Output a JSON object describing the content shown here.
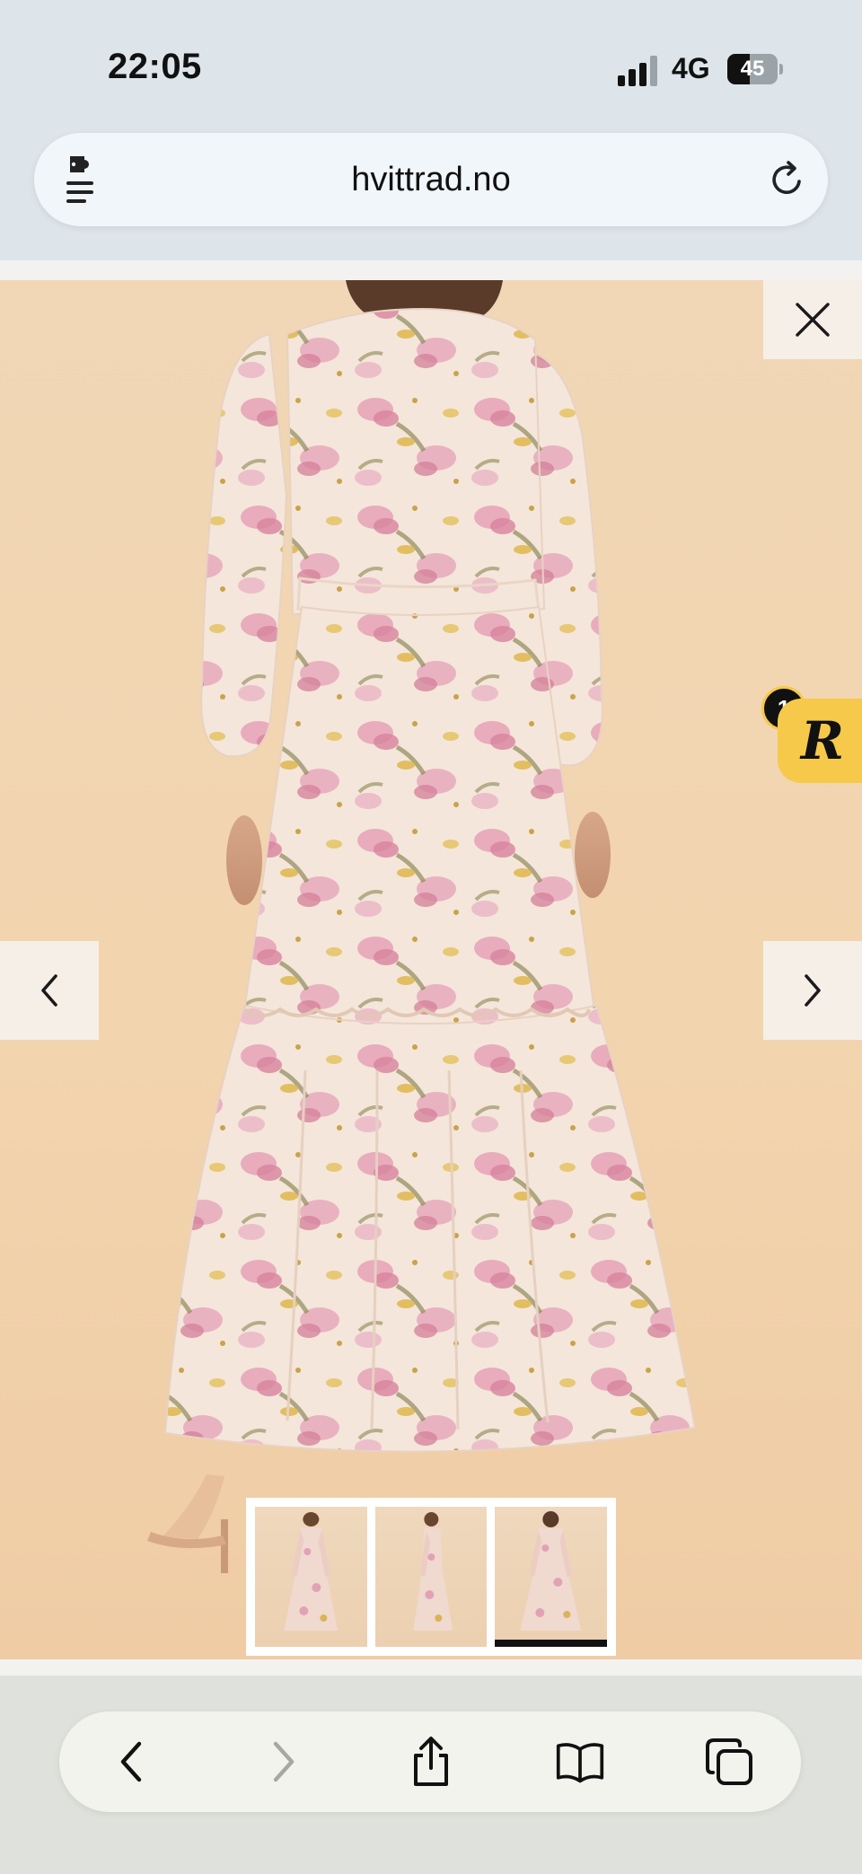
{
  "status_bar": {
    "time": "22:05",
    "network": "4G",
    "battery_percent": 45,
    "battery_label": "45"
  },
  "address_bar": {
    "url": "hvittrad.no",
    "left_icon": "extension-puzzle-icon",
    "right_icon": "reload-icon"
  },
  "gallery": {
    "close_icon": "close-icon",
    "prev_icon": "chevron-left-icon",
    "next_icon": "chevron-right-icon",
    "thumbnails": [
      {
        "view": "front",
        "active": false
      },
      {
        "view": "side",
        "active": false
      },
      {
        "view": "back",
        "active": true
      }
    ]
  },
  "review_widget": {
    "letter": "R",
    "count": "1",
    "color": "#f6c94b"
  },
  "toolbar": {
    "items": [
      {
        "icon": "back-chevron-icon",
        "enabled": true
      },
      {
        "icon": "forward-chevron-icon",
        "enabled": false
      },
      {
        "icon": "share-icon",
        "enabled": true
      },
      {
        "icon": "bookmarks-book-icon",
        "enabled": true
      },
      {
        "icon": "tabs-icon",
        "enabled": true
      }
    ]
  },
  "colors": {
    "chrome_bg": "#dde5ea",
    "photo_bg": "#f1d7b6",
    "dress_base": "#f3e4d8",
    "flower_pink": "#e39ab2",
    "flower_yellow": "#e0b84c"
  }
}
